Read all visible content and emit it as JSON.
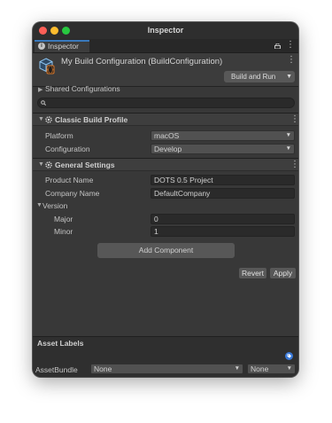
{
  "window": {
    "title": "Inspector"
  },
  "tab": {
    "label": "Inspector",
    "icon": "info-icon"
  },
  "header": {
    "title": "My Build Configuration (BuildConfiguration)",
    "build_button": "Build and Run",
    "icon": "build-config-cube-icon"
  },
  "shared_configurations": "Shared Configurations",
  "search": {
    "value": "",
    "icon": "search-icon"
  },
  "classic_build_profile": {
    "title": "Classic Build Profile",
    "platform_label": "Platform",
    "platform_value": "macOS",
    "configuration_label": "Configuration",
    "configuration_value": "Develop"
  },
  "general_settings": {
    "title": "General Settings",
    "product_name_label": "Product Name",
    "product_name_value": "DOTS 0.5 Project",
    "company_name_label": "Company Name",
    "company_name_value": "DefaultCompany",
    "version_label": "Version",
    "major_label": "Major",
    "major_value": "0",
    "minor_label": "Minor",
    "minor_value": "1"
  },
  "buttons": {
    "add_component": "Add Component",
    "revert": "Revert",
    "apply": "Apply"
  },
  "asset_labels": {
    "title": "Asset Labels",
    "asset_bundle_label": "AssetBundle",
    "bundle_value": "None",
    "variant_value": "None"
  },
  "colors": {
    "background": "#383838",
    "accent": "#3a79bb",
    "tag": "#3a79d8"
  }
}
